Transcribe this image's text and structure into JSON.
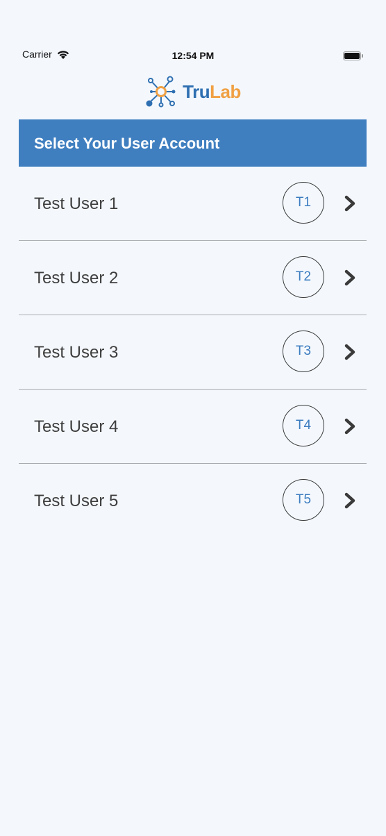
{
  "status_bar": {
    "carrier": "Carrier",
    "time": "12:54 PM",
    "icons": [
      "wifi-icon",
      "battery-icon"
    ]
  },
  "logo": {
    "part1": "Tru",
    "part2": "Lab",
    "icon": "molecule-logo-icon",
    "colors": {
      "tru": "#2e6fb1",
      "lab": "#f0a043"
    }
  },
  "header": {
    "title": "Select Your User Account",
    "color": "#3f7fc0"
  },
  "users": [
    {
      "name": "Test User 1",
      "initials": "T1"
    },
    {
      "name": "Test User 2",
      "initials": "T2"
    },
    {
      "name": "Test User 3",
      "initials": "T3"
    },
    {
      "name": "Test User 4",
      "initials": "T4"
    },
    {
      "name": "Test User 5",
      "initials": "T5"
    }
  ],
  "row_icon": "chevron-right-icon"
}
